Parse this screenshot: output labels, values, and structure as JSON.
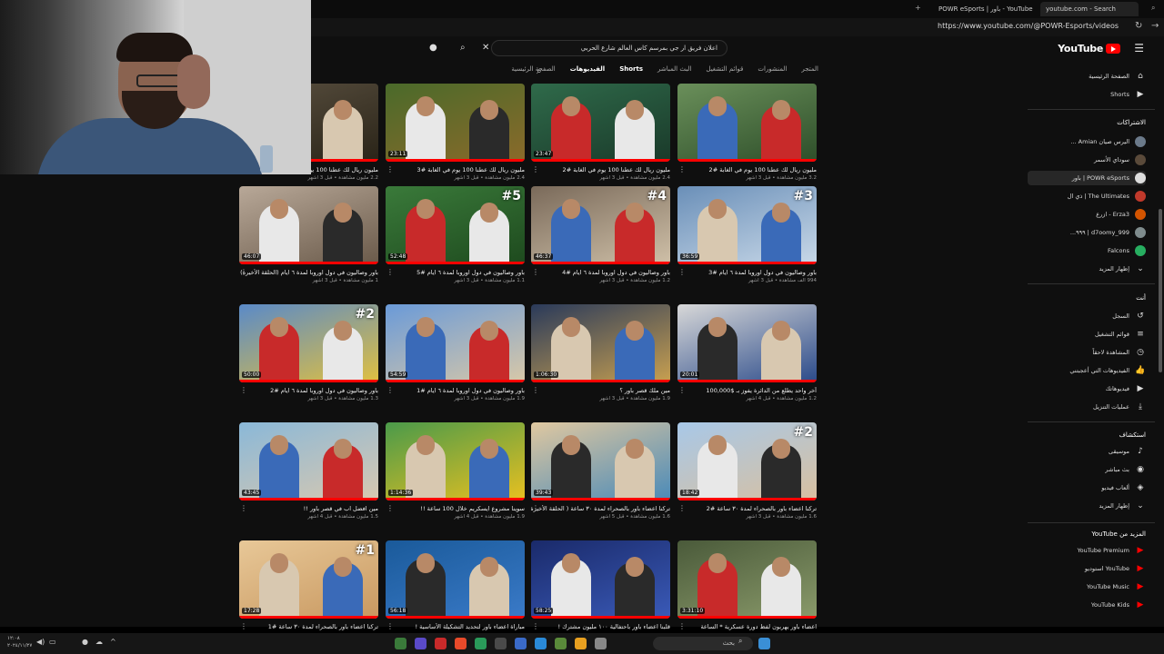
{
  "browser": {
    "tabs": [
      {
        "label": "POWR eSports | باور - YouTube",
        "active": false
      },
      {
        "label": "youtube.com - Search",
        "active": true
      }
    ],
    "url": "https://www.youtube.com/@POWR-Esports/videos"
  },
  "header": {
    "logo_text": "YouTube",
    "search_value": "اعلان فريق ار جي بمرسم كاس العالم شارع الحربي"
  },
  "channel_tabs": [
    "الصفحة الرئيسية",
    "الفيديوهات",
    "Shorts",
    "البث المباشر",
    "قوائم التشغيل",
    "المنشورات",
    "المتجر"
  ],
  "videos": [
    {
      "title": "مليون ريال لك عطنا 100 يوم في الغابة #2",
      "meta": "3.2 مليون مشاهدة • قبل 3 أشهر",
      "duration": "",
      "badge": ""
    },
    {
      "title": "مليون ريال لك عطنا 100 يوم في الغابة #2",
      "meta": "2.4 مليون مشاهدة • قبل 3 أشهر",
      "duration": "23:47",
      "badge": ""
    },
    {
      "title": "مليون ريال لك عطنا 100 يوم في الغابة #3",
      "meta": "2.4 مليون مشاهدة • قبل 3 أشهر",
      "duration": "23:11",
      "badge": ""
    },
    {
      "title": "مليون ريال لك عطنا 100 يوم في الغابة #4",
      "meta": "2.2 مليون مشاهدة • قبل 3 أشهر",
      "duration": "21:27",
      "badge": ""
    },
    {
      "title": "باور وصاليون في دول اوروبا لمدة ٦ ايام #3",
      "meta": "994 ألف مشاهدة • قبل 3 أشهر",
      "duration": "36:59",
      "badge": "#3"
    },
    {
      "title": "باور وصاليون في دول اوروبا لمدة ٦ ايام #4",
      "meta": "1.2 مليون مشاهدة • قبل 3 أشهر",
      "duration": "46:37",
      "badge": "#4"
    },
    {
      "title": "باور وصاليون في دول اوروبا لمدة ٦ ايام #5",
      "meta": "1.1 مليون مشاهدة • قبل 3 أشهر",
      "duration": "52:48",
      "badge": "#5"
    },
    {
      "title": "باور وصاليون في دول اوروبا لمدة ٦ ايام (الحلقة الأخيرة)",
      "meta": "1 مليون مشاهدة • قبل 3 أشهر",
      "duration": "46:07",
      "badge": ""
    },
    {
      "title": "آخر واحد يطلع من الدائرة يفوز بـ $100,000",
      "meta": "1.2 مليون مشاهدة • قبل 4 أشهر",
      "duration": "20:01",
      "badge": ""
    },
    {
      "title": "مين ملك قصر باور ؟",
      "meta": "1.9 مليون مشاهدة • قبل 3 أشهر",
      "duration": "1:06:30",
      "badge": ""
    },
    {
      "title": "باور وصاليون في دول اوروبا لمدة ٦ ايام #1",
      "meta": "1.9 مليون مشاهدة • قبل 3 أشهر",
      "duration": "54:59",
      "badge": ""
    },
    {
      "title": "باور وصاليون في دول اوروبا لمدة ٦ ايام #2",
      "meta": "1.3 مليون مشاهدة • قبل 3 أشهر",
      "duration": "50:00",
      "badge": "#2"
    },
    {
      "title": "تركنا اعضاء باور بالصحراء لمدة ٣٠ ساعة #2",
      "meta": "1.6 مليون مشاهدة • قبل 3 أشهر",
      "duration": "18:42",
      "badge": "#2"
    },
    {
      "title": "تركنا اعضاء باور بالصحراء لمدة ٣٠ ساعة ( الحلقة الأخيرة )",
      "meta": "1.6 مليون مشاهدة • قبل 5 أشهر",
      "duration": "39:43",
      "badge": ""
    },
    {
      "title": "سوينا مشروع ايسكريم خلال 100 ساعة !!",
      "meta": "1.9 مليون مشاهدة • قبل 4 أشهر",
      "duration": "1:14:36",
      "badge": ""
    },
    {
      "title": "مين افضل اب في قصر باور !!",
      "meta": "1.5 مليون مشاهدة • قبل 4 أشهر",
      "duration": "43:45",
      "badge": ""
    },
    {
      "title": "اعضاء باور يهربون لفظ دورة عسكرية * الساعة",
      "meta": "",
      "duration": "3:31:10",
      "badge": ""
    },
    {
      "title": "قلبنا اعضاء باور باحتفالية ١٠٠ مليون مشترك !",
      "meta": "",
      "duration": "58:25",
      "badge": ""
    },
    {
      "title": "مباراة اعضاء باور لتحديد التشكيلة الأساسية !",
      "meta": "",
      "duration": "56:18",
      "badge": ""
    },
    {
      "title": "تركنا اعضاء باور بالصحراء لمدة ٣٠ ساعة #1",
      "meta": "",
      "duration": "17:28",
      "badge": "#1"
    }
  ],
  "sidebar": {
    "top": [
      {
        "label": "الصفحة الرئيسية",
        "icon": "home-icon"
      },
      {
        "label": "Shorts",
        "icon": "shorts-icon"
      }
    ],
    "subs_header": "الاشتراكات",
    "subs": [
      {
        "label": "اليرس صيان Amian ...",
        "color": "#6b7a8a"
      },
      {
        "label": "سوداي الأسمر",
        "color": "#5a4a3a"
      },
      {
        "label": "POWR eSports | باور",
        "color": "#dddddd",
        "selected": true
      },
      {
        "label": "The Ultimates | ذي ال",
        "color": "#c0392b"
      },
      {
        "label": "Erza3 - ازرع",
        "color": "#d35400"
      },
      {
        "label": "d7oomy_999 | ٩٩٩...",
        "color": "#7f8c8d"
      },
      {
        "label": "Falcons",
        "color": "#27ae60"
      },
      {
        "label": "إظهار المزيد",
        "color": ""
      }
    ],
    "you_header": "أنت",
    "you": [
      {
        "label": "السجل",
        "icon": "history-icon"
      },
      {
        "label": "قوائم التشغيل",
        "icon": "playlist-icon"
      },
      {
        "label": "المشاهدة لاحقاً",
        "icon": "clock-icon"
      },
      {
        "label": "الفيديوهات التي أعجبتني",
        "icon": "like-icon"
      },
      {
        "label": "فيديوهاتك",
        "icon": "video-icon"
      },
      {
        "label": "عمليات التنزيل",
        "icon": "download-icon"
      }
    ],
    "explore_header": "استكشاف",
    "explore": [
      {
        "label": "موسيقى",
        "icon": "music-icon"
      },
      {
        "label": "بث مباشر",
        "icon": "live-icon"
      },
      {
        "label": "ألعاب فيديو",
        "icon": "game-icon"
      },
      {
        "label": "إظهار المزيد",
        "icon": "chevron-down-icon"
      }
    ],
    "more_header": "المزيد من YouTube",
    "more": [
      {
        "label": "YouTube Premium",
        "color": "#ff0000"
      },
      {
        "label": "YouTube استوديو",
        "color": "#ff0000"
      },
      {
        "label": "YouTube Music",
        "color": "#ff0000"
      },
      {
        "label": "YouTube Kids",
        "color": "#ff0000"
      }
    ]
  },
  "taskbar": {
    "search_placeholder": "بحث",
    "time": "١٢:٠٨",
    "date": "٢٠٢٤/١١/٢٧"
  },
  "colors": {
    "accent": "#ff0000",
    "page_bg": "#0f0f0f"
  }
}
